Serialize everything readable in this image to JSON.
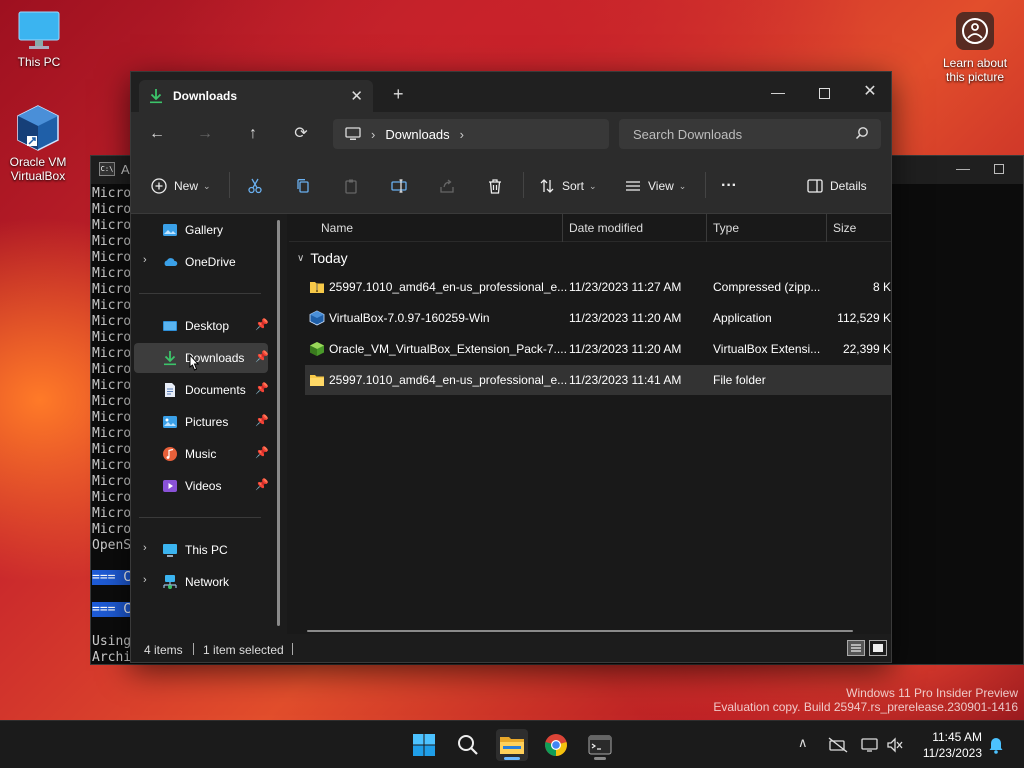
{
  "desktop": {
    "this_pc_label": "This PC",
    "virtualbox_label_1": "Oracle VM",
    "virtualbox_label_2": "VirtualBox",
    "learn_label_1": "Learn about",
    "learn_label_2": "this picture"
  },
  "terminal": {
    "title": "A",
    "lines": [
      "Micro",
      "Micro",
      "Micro",
      "Micro",
      "Micro",
      "Micro",
      "Micro",
      "Micro",
      "Micro",
      "Micro",
      "Micro",
      "Micro",
      "Micro",
      "Micro",
      "Micro",
      "Micro",
      "Micro",
      "Micro",
      "Micro",
      "Micro",
      "Micro",
      "Micro",
      "OpenS",
      "",
      "=== C",
      "",
      "=== C",
      "",
      "Using",
      "Archi"
    ]
  },
  "explorer": {
    "tab_title": "Downloads",
    "new_tab": "+",
    "address": {
      "crumb": "Downloads"
    },
    "search_placeholder": "Search Downloads",
    "commands": {
      "new": "New",
      "sort": "Sort",
      "view": "View",
      "more": "···",
      "details": "Details"
    },
    "sidebar": {
      "gallery": "Gallery",
      "onedrive": "OneDrive",
      "desktop": "Desktop",
      "downloads": "Downloads",
      "documents": "Documents",
      "pictures": "Pictures",
      "music": "Music",
      "videos": "Videos",
      "this_pc": "This PC",
      "network": "Network"
    },
    "columns": {
      "name": "Name",
      "date": "Date modified",
      "type": "Type",
      "size": "Size"
    },
    "group": "Today",
    "files": [
      {
        "name": "25997.1010_amd64_en-us_professional_e...",
        "date": "11/23/2023 11:27 AM",
        "type": "Compressed (zipp...",
        "size": "8 K"
      },
      {
        "name": "VirtualBox-7.0.97-160259-Win",
        "date": "11/23/2023 11:20 AM",
        "type": "Application",
        "size": "112,529 K"
      },
      {
        "name": "Oracle_VM_VirtualBox_Extension_Pack-7....",
        "date": "11/23/2023 11:20 AM",
        "type": "VirtualBox Extensi...",
        "size": "22,399 K"
      },
      {
        "name": "25997.1010_amd64_en-us_professional_e...",
        "date": "11/23/2023 11:41 AM",
        "type": "File folder",
        "size": ""
      }
    ],
    "status": {
      "items": "4 items",
      "selected": "1 item selected"
    }
  },
  "watermark": {
    "line1": "Windows 11 Pro Insider Preview",
    "line2": "Evaluation copy. Build 25947.rs_prerelease.230901-1416"
  },
  "taskbar": {
    "time": "11:45 AM",
    "date": "11/23/2023"
  },
  "colors": {
    "accent": "#6cb8ff",
    "folder": "#f7c948",
    "download_green": "#3cc46a"
  }
}
